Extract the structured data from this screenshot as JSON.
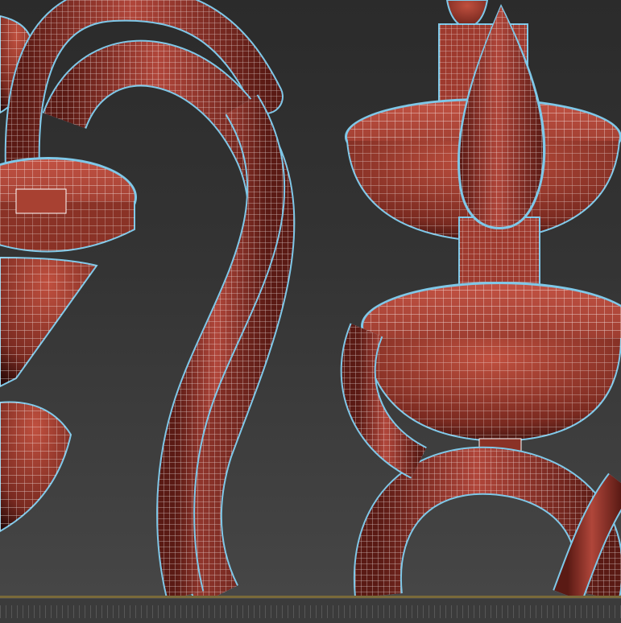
{
  "viewport": {
    "background_top": "#2b2b2b",
    "background_bottom": "#464646",
    "mesh_color": "#9e3a2e",
    "mesh_shadow": "#3a0e0a",
    "wire_color": "#ffffff",
    "selection_outline_color": "#7fc8e8",
    "objects": [
      "chandelier-arm-left",
      "chandelier-arm-center",
      "candle-holder-right",
      "candle-flame-mesh",
      "curved-arm-bottom-right"
    ]
  },
  "timeline": {
    "divider_color": "#7a6a3a",
    "track_color": "#3b3b3b"
  }
}
